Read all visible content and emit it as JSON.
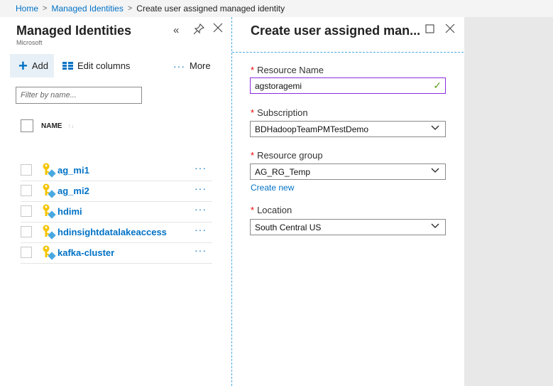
{
  "breadcrumb": {
    "home": "Home",
    "sep": ">",
    "managed_identities": "Managed Identities",
    "current": "Create user assigned managed identity"
  },
  "left_blade": {
    "title": "Managed Identities",
    "subtitle": "Microsoft",
    "collapse_glyph": "«",
    "pin_glyph": "📌",
    "close_glyph": "✕",
    "toolbar": {
      "add_label": "Add",
      "edit_columns_label": "Edit columns",
      "more_label": "More"
    },
    "filter_placeholder": "Filter by name...",
    "column_header": "NAME",
    "items": [
      {
        "name": "ag_mi1"
      },
      {
        "name": "ag_mi2"
      },
      {
        "name": "hdimi"
      },
      {
        "name": "hdinsightdatalakeaccess"
      },
      {
        "name": "kafka-cluster"
      }
    ],
    "row_more_glyph": "···"
  },
  "right_blade": {
    "title": "Create user assigned man...",
    "maximize_glyph": "☐",
    "close_glyph": "✕",
    "fields": {
      "resource_name": {
        "label": "Resource Name",
        "value": "agstoragemi"
      },
      "subscription": {
        "label": "Subscription",
        "value": "BDHadoopTeamPMTestDemo"
      },
      "resource_group": {
        "label": "Resource group",
        "value": "AG_RG_Temp"
      },
      "create_new": "Create new",
      "location": {
        "label": "Location",
        "value": "South Central US"
      }
    },
    "required_marker": "*"
  },
  "colors": {
    "link": "#0072c6",
    "active_border": "#8a2be2",
    "valid_check": "#5ea11b",
    "required": "#ee0000"
  }
}
